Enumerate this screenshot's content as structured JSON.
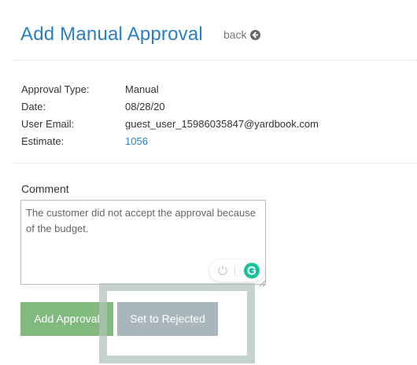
{
  "header": {
    "title": "Add Manual Approval",
    "back_label": "back"
  },
  "details": [
    {
      "label": "Approval Type:",
      "value": "Manual"
    },
    {
      "label": "Date:",
      "value": "08/28/20"
    },
    {
      "label": "User Email:",
      "value": "guest_user_15986035847@yardbook.com"
    },
    {
      "label": "Estimate:",
      "value": "1056"
    }
  ],
  "comment": {
    "label": "Comment",
    "value": "The customer did not accept the approval because of the budget."
  },
  "buttons": {
    "add_approval": "Add Approval",
    "set_rejected": "Set to Rejected"
  },
  "colors": {
    "title": "#2a7fc0",
    "link": "#2a7fc0",
    "approve_button": "#82b97f",
    "reject_button": "#a9b6bc",
    "grammarly": "#15c39a"
  },
  "icons": [
    "back-arrow-icon",
    "power-icon",
    "grammarly-icon",
    "resize-handle-icon"
  ]
}
